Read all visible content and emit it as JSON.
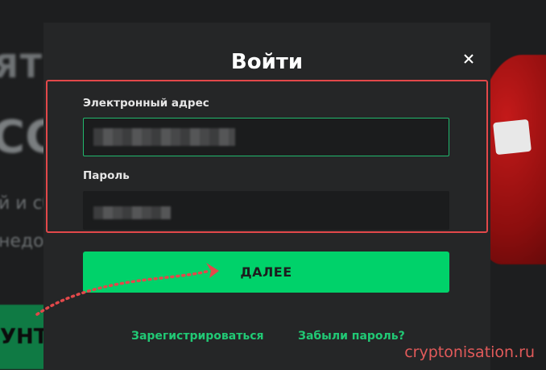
{
  "background": {
    "heading_fragment_1": "ЯТ",
    "heading_fragment_2": "СС",
    "text_fragment_1": "й и сб",
    "text_fragment_2": "недо",
    "button_fragment": "УНТ"
  },
  "modal": {
    "title": "Войти",
    "close_icon": "close-icon",
    "email_label": "Электронный адрес",
    "password_label": "Пароль",
    "next_button": "ДАЛЕЕ",
    "register_link": "Зарегистрироваться",
    "forgot_link": "Забыли пароль?"
  },
  "watermark": "cryptonisation.ru",
  "colors": {
    "accent_green": "#00d26a",
    "link_green": "#21c975",
    "highlight_red": "#e2484a",
    "modal_bg": "#252627"
  }
}
